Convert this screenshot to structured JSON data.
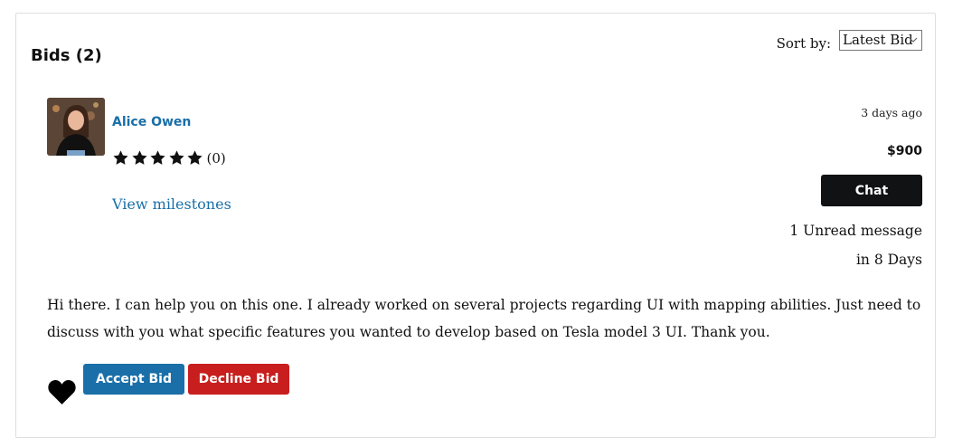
{
  "header": {
    "title": "Bids (2)",
    "sort_label": "Sort by:",
    "sort_value": "Latest Bid"
  },
  "bid": {
    "bidder_name": "Alice Owen",
    "rating_stars": 5,
    "rating_count": "(0)",
    "milestones_link": "View milestones",
    "time_ago": "3 days ago",
    "amount": "$900",
    "chat_label": "Chat",
    "unread": "1 Unread message",
    "delivery": "in 8 Days",
    "description": "Hi there. I can help you on this one. I already worked on several projects regarding UI with mapping abilities. Just need to discuss with you what specific features you wanted to develop based on Tesla model 3 UI. Thank you.",
    "accept_label": "Accept Bid",
    "decline_label": "Decline Bid"
  },
  "colors": {
    "link": "#1a6fa8",
    "accept": "#1a6fa8",
    "decline": "#c81e1e",
    "chat": "#111214"
  },
  "icons": [
    "star-icon",
    "heart-icon",
    "chevron-down-icon"
  ]
}
